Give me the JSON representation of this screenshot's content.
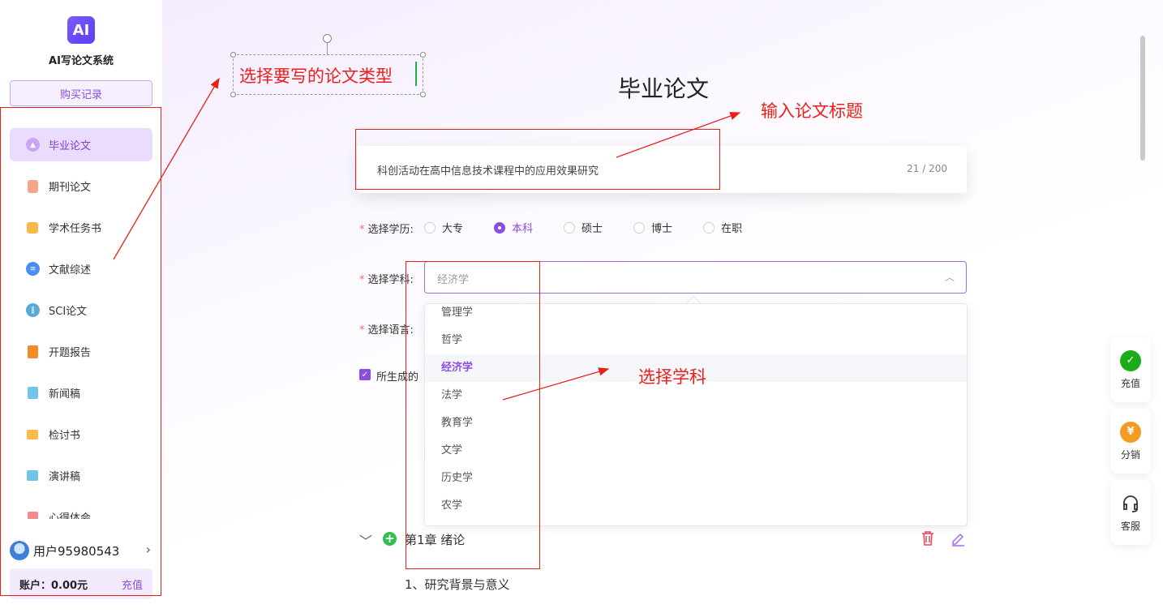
{
  "app": {
    "logo_text": "AI",
    "name": "AI写论文系统",
    "buy_records": "购买记录"
  },
  "sidebar": {
    "items": [
      {
        "label": "毕业论文",
        "icon": "graduation-cap-icon",
        "active": true
      },
      {
        "label": "期刊论文",
        "icon": "journal-icon"
      },
      {
        "label": "学术任务书",
        "icon": "task-book-icon"
      },
      {
        "label": "文献综述",
        "icon": "list-icon"
      },
      {
        "label": "SCI论文",
        "icon": "books-icon"
      },
      {
        "label": "开题报告",
        "icon": "report-icon"
      },
      {
        "label": "新闻稿",
        "icon": "news-icon"
      },
      {
        "label": "检讨书",
        "icon": "letter-icon"
      },
      {
        "label": "演讲稿",
        "icon": "speech-icon"
      },
      {
        "label": "心得体会",
        "icon": "heart-note-icon"
      }
    ],
    "user_name": "用户95980543",
    "account_label": "账户：0.00元",
    "recharge": "充值"
  },
  "main": {
    "title": "毕业论文",
    "paper_title_value": "科创活动在高中信息技术课程中的应用效果研究",
    "paper_title_count": "21 / 200",
    "education_label": "选择学历:",
    "education_options": [
      "大专",
      "本科",
      "硕士",
      "博士",
      "在职"
    ],
    "education_selected": "本科",
    "subject_label": "选择学科:",
    "subject_value": "经济学",
    "subject_options": [
      "管理学",
      "哲学",
      "经济学",
      "法学",
      "教育学",
      "文学",
      "历史学",
      "农学"
    ],
    "language_label": "选择语言:",
    "checkbox_label": "所生成的",
    "chapter_title": "第1章 绪论",
    "section_title": "1、研究背景与意义"
  },
  "floating": {
    "recharge": "充值",
    "distribution": "分销",
    "service": "客服"
  },
  "annotations": {
    "choose_type": "选择要写的论文类型",
    "enter_title": "输入论文标题",
    "choose_subject": "选择学科"
  },
  "colors": {
    "accent": "#8a4fe0",
    "annotation": "#e8201a"
  }
}
